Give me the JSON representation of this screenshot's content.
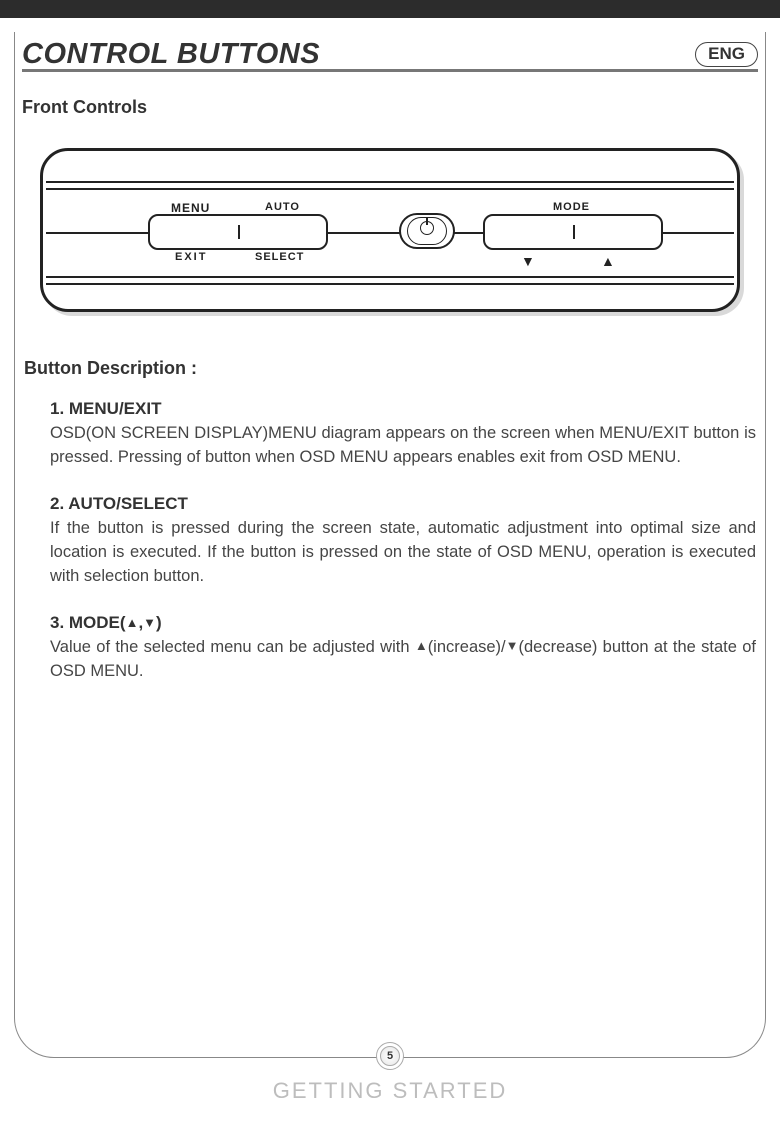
{
  "header": {
    "title": "CONTROL BUTTONS",
    "lang": "ENG"
  },
  "subhead": "Front Controls",
  "panel": {
    "labels": {
      "menu": "MENU",
      "auto": "AUTO",
      "exit": "EXIT",
      "select": "SELECT",
      "mode": "MODE"
    },
    "arrows": {
      "down": "▼",
      "up": "▲"
    }
  },
  "description": {
    "heading": "Button Description :",
    "items": [
      {
        "title": "1. MENU/EXIT",
        "body": "OSD(ON SCREEN DISPLAY)MENU diagram appears on the screen when MENU/EXIT button is pressed. Pressing of button when OSD MENU appears enables exit from OSD MENU."
      },
      {
        "title": "2. AUTO/SELECT",
        "body": "If the button is pressed during the screen state, automatic adjustment into optimal size and location is executed. If the button is pressed on the state of OSD MENU, operation is executed with selection button."
      },
      {
        "title_pre": "3. MODE(",
        "title_mid": ",",
        "title_post": ")",
        "body_pre": "Value of the selected menu can be adjusted with ",
        "body_mid1": "(increase)/",
        "body_mid2": "(decrease) button at the state of OSD MENU."
      }
    ]
  },
  "page_number": "5",
  "footer": "GETTING STARTED"
}
